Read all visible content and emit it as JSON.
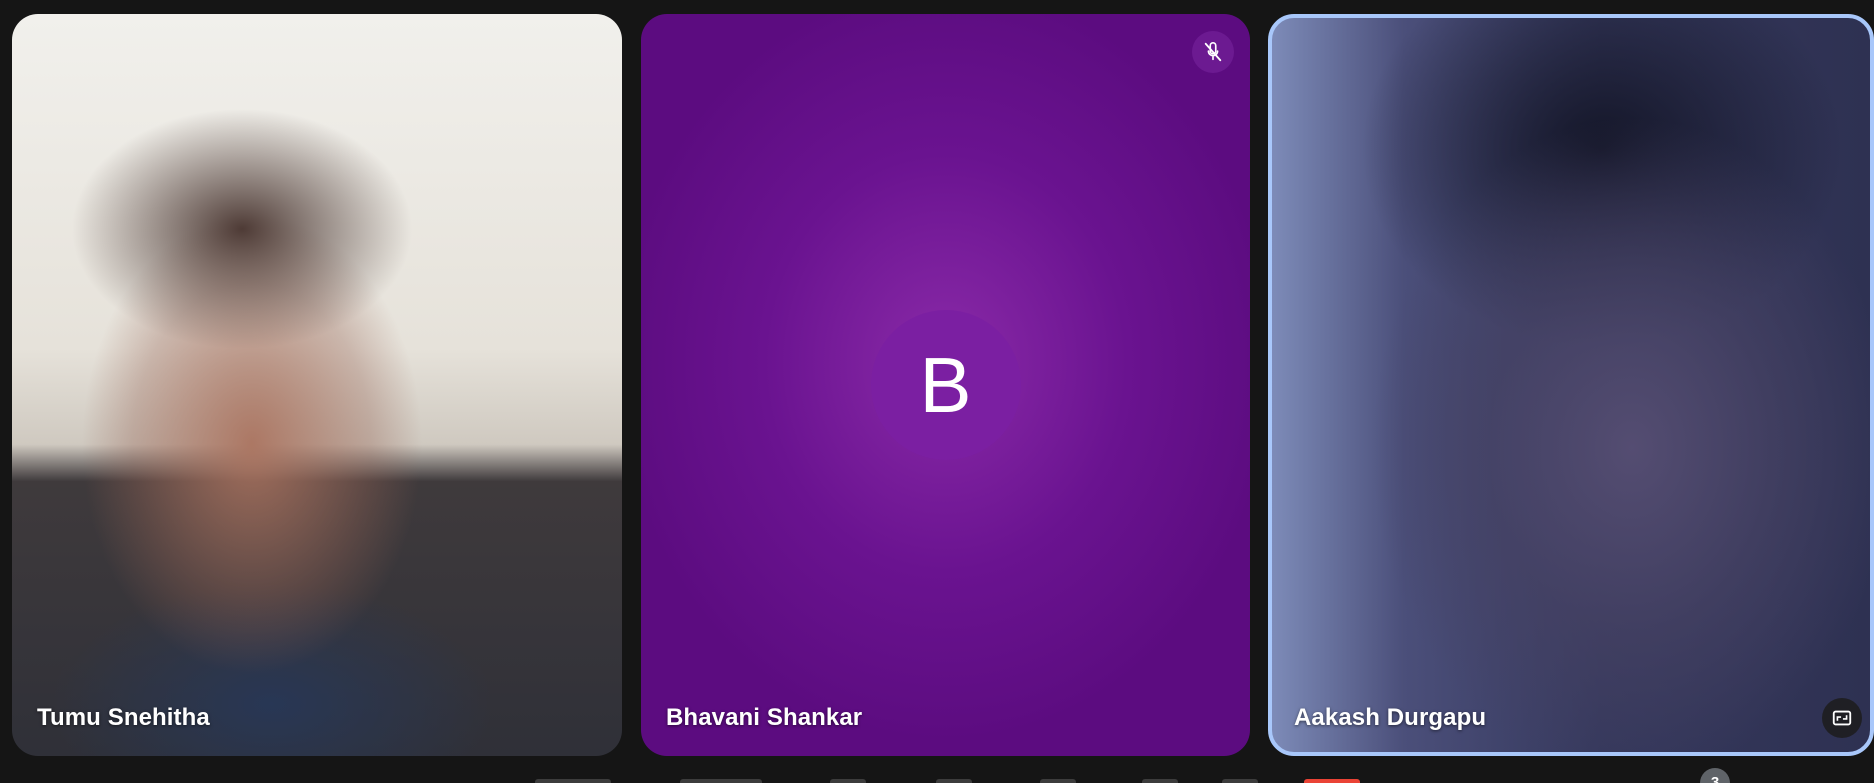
{
  "participants": [
    {
      "name": "Tumu Snehitha"
    },
    {
      "name": "Bhavani Shankar",
      "avatar_letter": "B",
      "muted": true
    },
    {
      "name": "Aakash Durgapu",
      "active_speaker": true
    }
  ],
  "toolbar": {
    "participants_count": "3"
  },
  "colors": {
    "active_speaker_border": "#a8c7fa",
    "avatar_background": "#7b1fa2",
    "tile_background": "#5c0c80",
    "end_call_red": "#ea4335"
  },
  "icons": {
    "mute": "mic-off-icon",
    "pin": "expand-icon"
  }
}
